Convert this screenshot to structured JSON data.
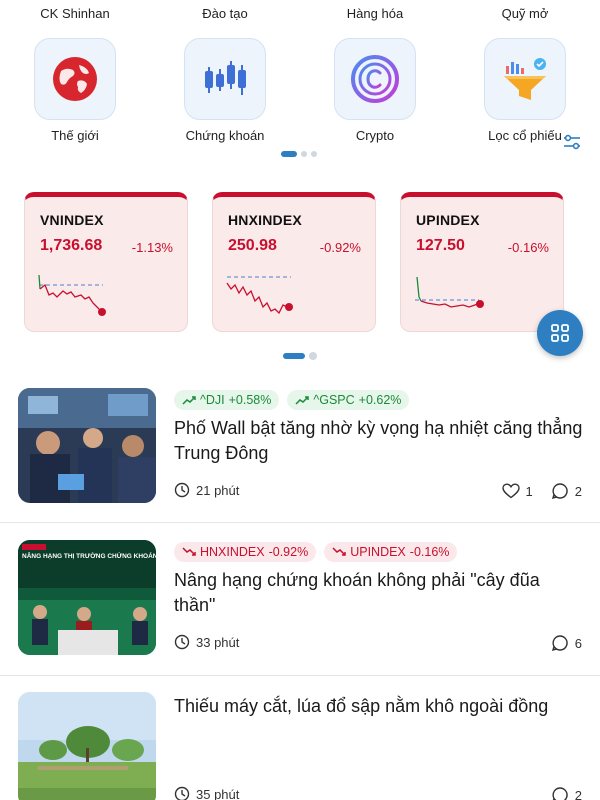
{
  "top_categories": [
    "CK Shinhan",
    "Đào tạo",
    "Hàng hóa",
    "Quỹ mở"
  ],
  "shortcuts": [
    {
      "label": "Thế giới",
      "icon": "globe-icon"
    },
    {
      "label": "Chứng khoán",
      "icon": "candlestick-icon"
    },
    {
      "label": "Crypto",
      "icon": "crypto-coin-icon"
    },
    {
      "label": "Lọc cổ phiếu",
      "icon": "stock-filter-funnel-icon"
    }
  ],
  "colors": {
    "accent": "#2d7fc1",
    "down": "#c8102e",
    "up": "#1b8a3a",
    "card_bg": "#fbeaea"
  },
  "indices": [
    {
      "name": "VNINDEX",
      "value": "1,736.68",
      "change": "-1.13%"
    },
    {
      "name": "HNXINDEX",
      "value": "250.98",
      "change": "-0.92%"
    },
    {
      "name": "UPINDEX",
      "value": "127.50",
      "change": "-0.16%"
    }
  ],
  "news": [
    {
      "tags": [
        {
          "label": "^DJI",
          "change": "+0.58%",
          "direction": "up"
        },
        {
          "label": "^GSPC",
          "change": "+0.62%",
          "direction": "up"
        }
      ],
      "headline": "Phố Wall bật tăng nhờ kỳ vọng hạ nhiệt căng thẳng Trung Đông",
      "time": "21 phút",
      "likes": "1",
      "comments": "2"
    },
    {
      "tags": [
        {
          "label": "HNXINDEX",
          "change": "-0.92%",
          "direction": "down"
        },
        {
          "label": "UPINDEX",
          "change": "-0.16%",
          "direction": "down"
        }
      ],
      "headline": "Nâng hạng chứng khoán không phải \"cây đũa thần\"",
      "thumb_text": "NÂNG HẠNG THỊ TRƯỜNG CHỨNG KHOÁN: CƠ HỘI THẬT HAY SÓNG KỲ VỌNG?",
      "time": "33 phút",
      "comments": "6"
    },
    {
      "headline": "Thiếu máy cắt, lúa đổ sập nằm khô ngoài đồng",
      "time": "35 phút",
      "comments": "2"
    }
  ]
}
